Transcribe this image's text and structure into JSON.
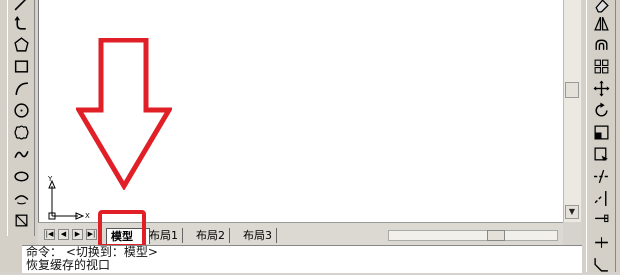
{
  "tabs": {
    "model": "模型",
    "layout1": "布局1",
    "layout2": "布局2",
    "layout3": "布局3"
  },
  "command": {
    "line1": "命令：  <切换到：模型>",
    "line2": "恢复缓存的视口"
  },
  "ucs": {
    "y_label": "Y",
    "x_label": "X"
  },
  "left_tools": [
    "line-icon",
    "polyline-icon",
    "polygon-icon",
    "rectangle-icon",
    "arc-icon",
    "circle-icon",
    "revcloud-icon",
    "spline-icon",
    "ellipse-icon",
    "ellipse-arc-icon"
  ],
  "right_tools": [
    "erase-icon",
    "mirror-icon",
    "offset-icon",
    "array-icon",
    "move-icon",
    "rotate-icon",
    "scale-icon",
    "stretch-icon",
    "trim-icon",
    "extend-icon",
    "break-icon"
  ],
  "colors": {
    "annotation_red": "#e01f26",
    "canvas": "#ffffff",
    "toolbar": "#d4d0c8"
  }
}
